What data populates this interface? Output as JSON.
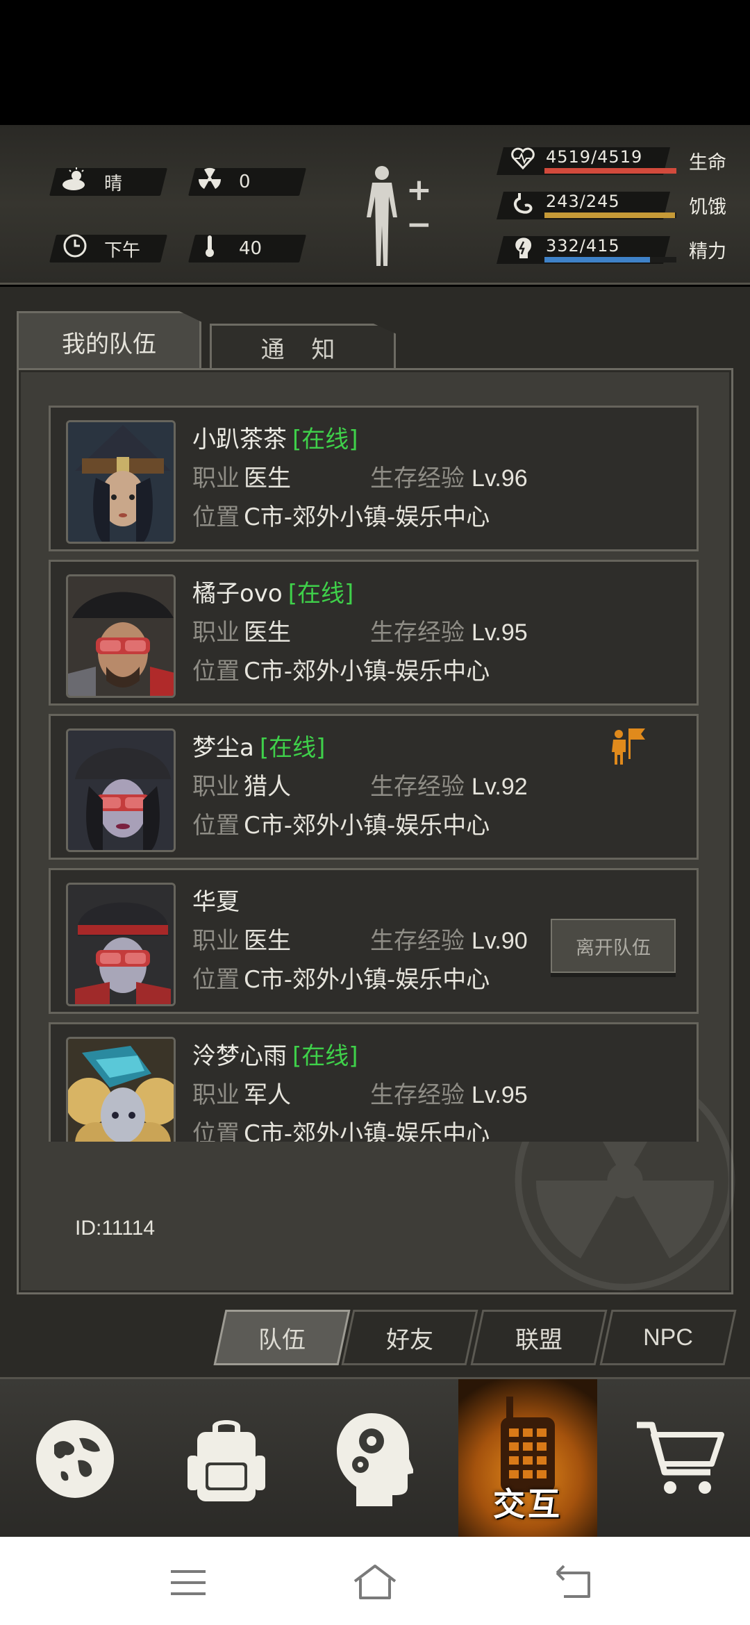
{
  "hud": {
    "weather": "晴",
    "radiation": "0",
    "time_of_day": "下午",
    "temperature": "40",
    "stats": [
      {
        "label": "生命",
        "value": "4519/4519",
        "fraction": 1.0,
        "color": "#d24a3c",
        "icon": "heart-icon"
      },
      {
        "label": "饥饿",
        "value": "243/245",
        "fraction": 0.99,
        "color": "#c69a37",
        "icon": "stomach-icon"
      },
      {
        "label": "精力",
        "value": "332/415",
        "fraction": 0.8,
        "color": "#3f82c8",
        "icon": "energy-icon"
      }
    ]
  },
  "tabs": {
    "team": "我的队伍",
    "notice": "通 知"
  },
  "labels": {
    "job": "职业",
    "exp": "生存经验",
    "location": "位置",
    "online": "[在线]",
    "leave": "离开队伍"
  },
  "members": [
    {
      "name": "小趴茶茶",
      "online": "[在线]",
      "job": "医生",
      "level": "Lv.96",
      "location": "C市-郊外小镇-娱乐中心"
    },
    {
      "name": "橘子ovo",
      "online": "[在线]",
      "job": "医生",
      "level": "Lv.95",
      "location": "C市-郊外小镇-娱乐中心"
    },
    {
      "name": "梦尘a",
      "online": "[在线]",
      "job": "猎人",
      "level": "Lv.92",
      "location": "C市-郊外小镇-娱乐中心"
    },
    {
      "name": "华夏",
      "online": "",
      "job": "医生",
      "level": "Lv.90",
      "location": "C市-郊外小镇-娱乐中心"
    },
    {
      "name": "泠梦心雨",
      "online": "[在线]",
      "job": "军人",
      "level": "Lv.95",
      "location": "C市-郊外小镇-娱乐中心"
    }
  ],
  "id_text": "ID:11114",
  "subtabs": [
    "队伍",
    "好友",
    "联盟",
    "NPC"
  ],
  "nav": {
    "interact_label": "交互"
  }
}
